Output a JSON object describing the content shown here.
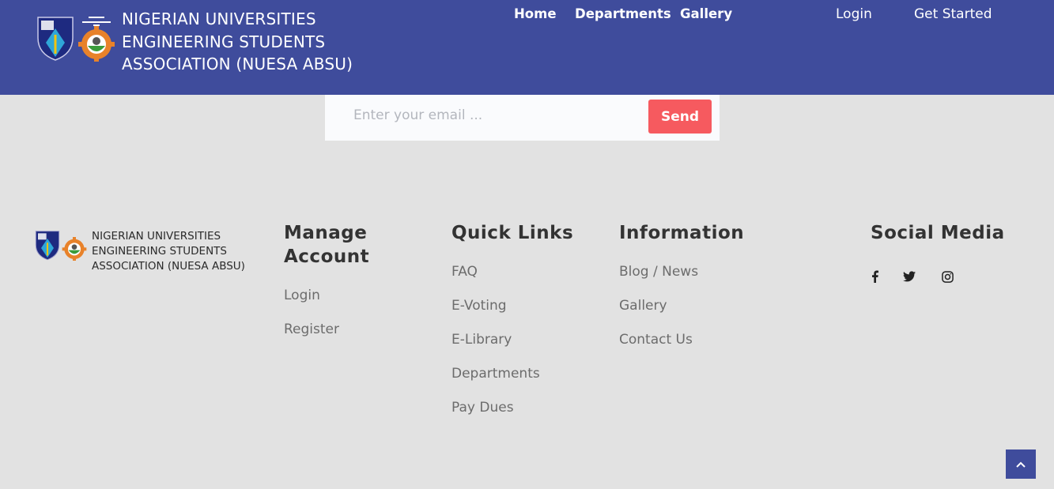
{
  "header": {
    "brand_name": "NIGERIAN UNIVERSITIES\nENGINEERING STUDENTS\nASSOCIATION (NUESA ABSU)",
    "nav": [
      {
        "label": "Home"
      },
      {
        "label": "Departments"
      },
      {
        "label": "Gallery"
      }
    ],
    "login_label": "Login",
    "get_started_label": "Get Started"
  },
  "newsletter": {
    "placeholder": "Enter your email ...",
    "send_label": "Send"
  },
  "footer": {
    "brand_name": "NIGERIAN UNIVERSITIES\nENGINEERING STUDENTS\nASSOCIATION (NUESA ABSU)",
    "manage_account": {
      "title": "Manage Account",
      "items": [
        {
          "label": "Login"
        },
        {
          "label": "Register"
        }
      ]
    },
    "quick_links": {
      "title": "Quick Links",
      "items": [
        {
          "label": "FAQ"
        },
        {
          "label": "E-Voting"
        },
        {
          "label": "E-Library"
        },
        {
          "label": "Departments"
        },
        {
          "label": "Pay Dues"
        }
      ]
    },
    "information": {
      "title": "Information",
      "items": [
        {
          "label": "Blog / News"
        },
        {
          "label": "Gallery"
        },
        {
          "label": "Contact Us"
        }
      ]
    },
    "social": {
      "title": "Social Media",
      "icons": [
        "facebook-icon",
        "twitter-icon",
        "instagram-icon"
      ]
    }
  },
  "colors": {
    "header_bg": "#3f4c9c",
    "send_button": "#f65a5f",
    "page_bg": "#e2e2e2"
  }
}
